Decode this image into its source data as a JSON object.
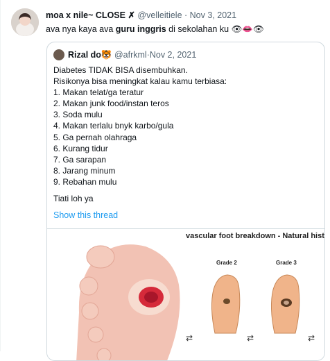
{
  "tweet": {
    "author_name": "moa x nile~ CLOSE",
    "close_glyph": "✗",
    "handle": "@velleitiele",
    "separator": " · ",
    "date": "Nov 3, 2021",
    "text_before": "ava nya kaya ava ",
    "text_bold": "guru inggris",
    "text_after": " di sekolahan ku 👁👄👁"
  },
  "quote": {
    "author_name": "Rizal do🐯",
    "handle": "@afrkml",
    "separator": " · ",
    "date": "Nov 2, 2021",
    "lines": [
      "Diabetes TIDAK BISA disembuhkan.",
      "Risikonya bisa meningkat kalau kamu terbiasa:",
      "1. Makan telat/ga teratur",
      "2. Makan junk food/instan teros",
      "3. Soda mulu",
      "4. Makan terlalu bnyk karbo/gula",
      "5. Ga pernah olahraga",
      "6. Kurang tidur",
      "7. Ga sarapan",
      "8. Jarang minum",
      "9. Rebahan mulu"
    ],
    "closing": "Tiati loh ya",
    "show_thread": "Show this thread"
  },
  "media": {
    "caption": "vascular foot breakdown - Natural hist",
    "grade2": "Grade 2",
    "grade3": "Grade 3",
    "arrow_glyph": "⇄",
    "skin_color": "#f0b8a8",
    "wound_color": "#d52a3a"
  }
}
